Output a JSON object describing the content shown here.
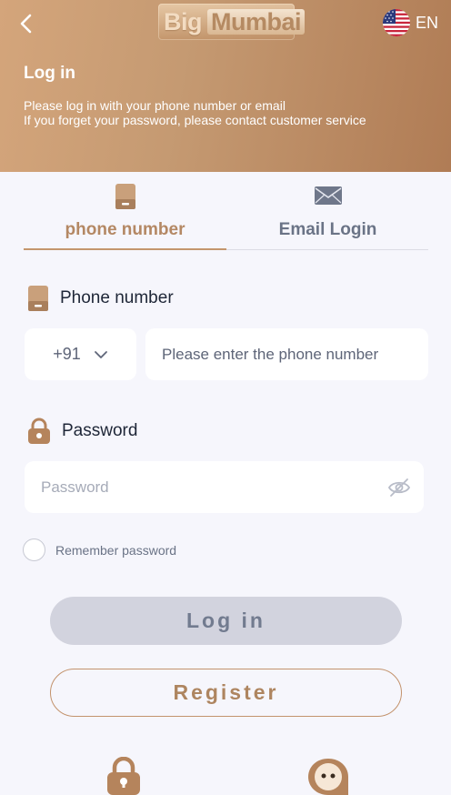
{
  "header": {
    "logo_big": "Big",
    "logo_mumbai": "Mumbai",
    "language": "EN",
    "title": "Log in",
    "subtitle_1": "Please log in with your phone number or email",
    "subtitle_2": "If you forget your password, please contact customer service"
  },
  "tabs": [
    {
      "label": "phone number",
      "icon": "phone-icon",
      "active": true
    },
    {
      "label": "Email Login",
      "icon": "mail-icon",
      "active": false
    }
  ],
  "form": {
    "phone_label": "Phone number",
    "country_code": "+91",
    "phone_placeholder": "Please enter the phone number",
    "password_label": "Password",
    "password_placeholder": "Password",
    "remember_label": "Remember password"
  },
  "buttons": {
    "login": "Log in",
    "register": "Register"
  },
  "colors": {
    "accent": "#c4966d",
    "header_start": "#d4a57b",
    "header_end": "#b07c55",
    "background": "#f6f6fc",
    "login_disabled": "#d2d3de"
  }
}
